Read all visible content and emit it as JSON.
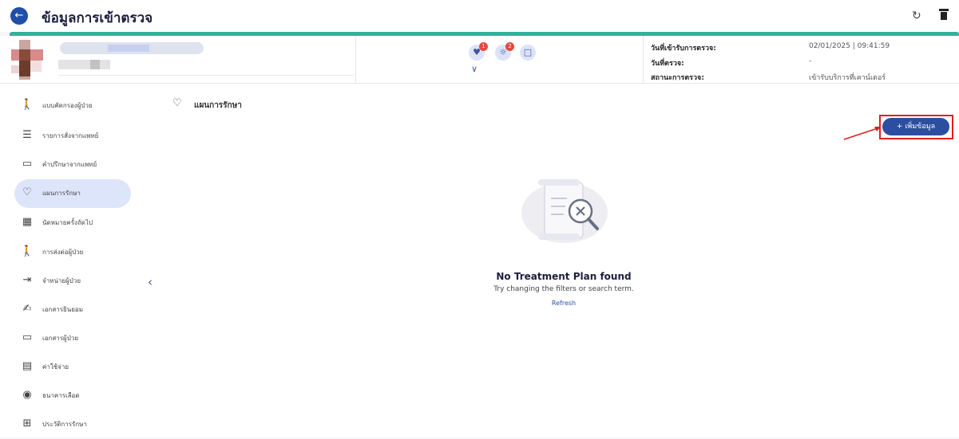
{
  "header": {
    "title": "ข้อมูลการเข้าตรวจ",
    "back_icon": "arrow-left-icon",
    "refresh_icon": "refresh-icon",
    "delete_icon": "trash-icon"
  },
  "patient_header": {
    "accent_color": "#2fb39c",
    "action_icons": [
      {
        "name": "vitals-icon",
        "badge": "1"
      },
      {
        "name": "settings-icon",
        "badge": "2"
      },
      {
        "name": "note-icon",
        "badge": ""
      }
    ],
    "info": [
      {
        "label": "วันที่เข้ารับการตรวจ:",
        "value": "02/01/2025 | 09:41:59"
      },
      {
        "label": "วันที่ตรวจ:",
        "value": "-"
      },
      {
        "label": "สถานะการตรวจ:",
        "value": "เข้ารับบริการที่เคาน์เตอร์"
      }
    ]
  },
  "sidebar": {
    "items": [
      {
        "label": "แบบคัดกรองผู้ป่วย",
        "icon": "person-search-icon"
      },
      {
        "label": "รายการสั่งจากแพทย์",
        "icon": "list-icon"
      },
      {
        "label": "คำปรึกษาจากแพทย์",
        "icon": "chat-icon"
      },
      {
        "label": "แผนการรักษา",
        "icon": "hand-heart-icon",
        "active": true
      },
      {
        "label": "นัดหมายครั้งถัดไป",
        "icon": "calendar-icon"
      },
      {
        "label": "การส่งต่อผู้ป่วย",
        "icon": "walking-person-icon"
      },
      {
        "label": "จำหน่ายผู้ป่วย",
        "icon": "exit-icon"
      },
      {
        "label": "เอกสารยินยอม",
        "icon": "signature-icon"
      },
      {
        "label": "เอกสารผู้ป่วย",
        "icon": "folder-icon"
      },
      {
        "label": "ค่าใช้จ่าย",
        "icon": "receipt-icon"
      },
      {
        "label": "ธนาคารเลือด",
        "icon": "blood-drop-icon"
      },
      {
        "label": "ประวัติการรักษา",
        "icon": "medical-bag-icon"
      }
    ],
    "active_color": "#dde5fa"
  },
  "main": {
    "section_title": "แผนการรักษา",
    "add_button_label": "+  เพิ่มข้อมูล",
    "empty_state": {
      "title": "No Treatment Plan found",
      "subtitle": "Try changing the filters or search term.",
      "link": "Refresh"
    },
    "button_color": "#2b4ea0",
    "highlight_color": "#e41e1e"
  }
}
